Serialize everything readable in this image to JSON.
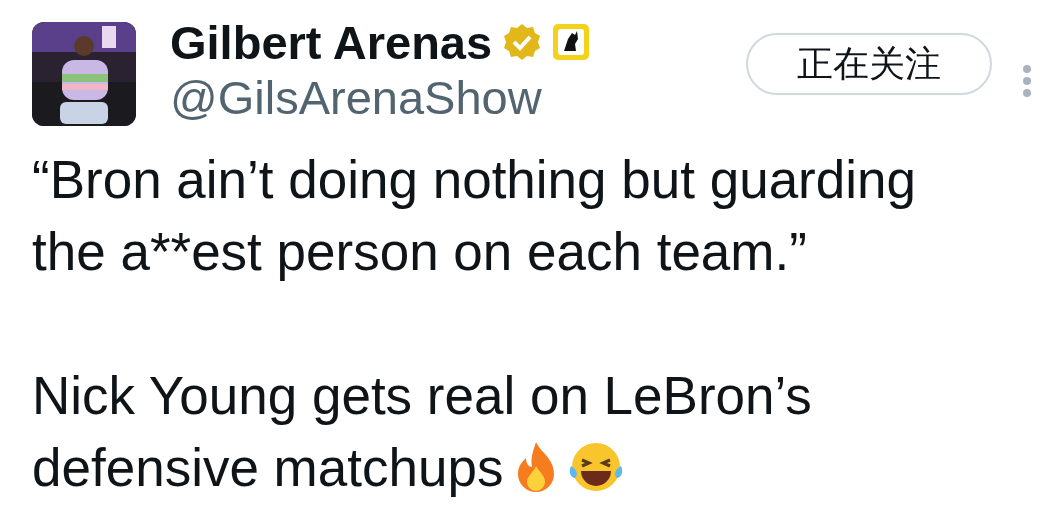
{
  "author": {
    "name": "Gilbert Arenas",
    "verified": true,
    "handle": "@GilsArenaShow"
  },
  "follow_button": {
    "label": "正在关注",
    "following": true
  },
  "tweet": {
    "paragraphs": [
      {
        "lines": [
          "“Bron ain’t doing nothing but guarding",
          "the a**est person on each team.”"
        ]
      },
      {
        "lines": [
          "Nick Young gets real on LeBron’s",
          "defensive matchups"
        ],
        "emojis": [
          {
            "kind": "fire"
          },
          {
            "kind": "laughing"
          }
        ]
      }
    ]
  }
}
